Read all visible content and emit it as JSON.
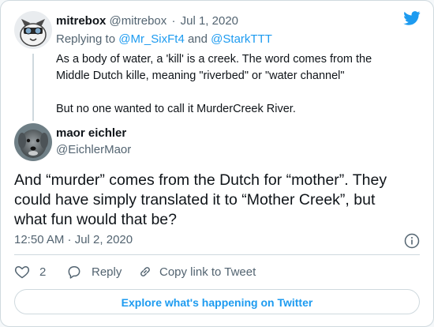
{
  "colors": {
    "accent": "#1d9bf0",
    "secondary_text": "#536471",
    "border": "#cfd9de"
  },
  "reply_tweet": {
    "author_name": "mitrebox",
    "author_handle": "@mitrebox",
    "separator": "·",
    "date": "Jul 1, 2020",
    "replying_prefix": "Replying to",
    "replying_user1": "@Mr_SixFt4",
    "replying_and": "and",
    "replying_user2": "@StarkTTT",
    "text_paragraph1": "As a body of water, a 'kill' is a creek. The word comes from the Middle Dutch kille, meaning \"riverbed\" or \"water channel\"",
    "text_paragraph2": "But no one wanted to call it MurderCreek River."
  },
  "main_tweet": {
    "author_name": "maor eichler",
    "author_handle": "@EichlerMaor",
    "text": "And “murder” comes from the Dutch for “mother”. They could have simply translated it to “Mother Creek”, but what fun would that be?",
    "timestamp": "12:50 AM · Jul 2, 2020",
    "like_count": "2",
    "reply_label": "Reply",
    "copy_link_label": "Copy link to Tweet"
  },
  "explore_button": {
    "label": "Explore what's happening on Twitter"
  },
  "icons": {
    "brand": "twitter-bird-icon",
    "info": "info-icon",
    "like": "heart-icon",
    "reply": "speech-bubble-icon",
    "copy_link": "link-icon"
  }
}
